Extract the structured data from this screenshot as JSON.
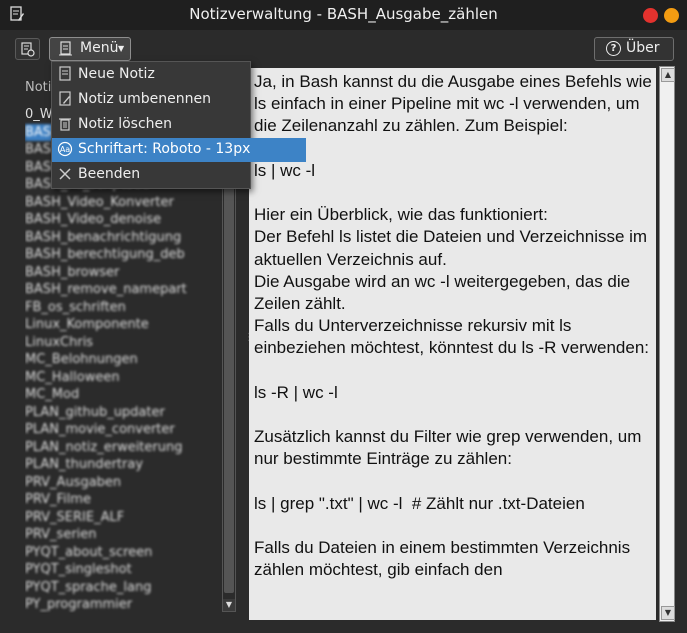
{
  "window": {
    "title": "Notizverwaltung - BASH_Ausgabe_zählen",
    "colors": {
      "close": "#e3322e",
      "minimize": "#f39c12",
      "selection": "#3c7fc2"
    }
  },
  "toolbar": {
    "menu_label": "Menü",
    "about_label": "Über"
  },
  "sidebar": {
    "header": "Noti",
    "notes": [
      "0_W...",
      "BASH_Ausgabe_zählen",
      "BASH_PDF_Verkleinern",
      "BASH_PDF_tail_bat_cat",
      "BASH_PY_scriptbau",
      "BASH_Video_Konverter",
      "BASH_Video_denoise",
      "BASH_benachrichtigung",
      "BASH_berechtigung_deb",
      "BASH_browser",
      "BASH_remove_namepart",
      "FB_os_schriften",
      "Linux_Komponente",
      "LinuxChris",
      "MC_Belohnungen",
      "MC_Halloween",
      "MC_Mod",
      "PLAN_github_updater",
      "PLAN_movie_converter",
      "PLAN_notiz_erweiterung",
      "PLAN_thundertray",
      "PRV_Ausgaben",
      "PRV_Filme",
      "PRV_SERIE_ALF",
      "PRV_serien",
      "PYQT_about_screen",
      "PYQT_singleshot",
      "PYQT_sprache_lang",
      "PY_programmier"
    ],
    "selected_index": 1
  },
  "menu": {
    "items": [
      {
        "label": "Neue Notiz",
        "icon": "new-note-icon"
      },
      {
        "label": "Notiz umbenennen",
        "icon": "rename-note-icon"
      },
      {
        "label": "Notiz löschen",
        "icon": "trash-icon"
      },
      {
        "label": "Schriftart: Roboto  - 13px",
        "icon": "font-icon"
      },
      {
        "label": "Beenden",
        "icon": "exit-icon"
      }
    ],
    "highlighted_index": 3
  },
  "editor": {
    "content": "Ja, in Bash kannst du die Ausgabe eines Befehls wie ls einfach in einer Pipeline mit wc -l verwenden, um die Zeilenanzahl zu zählen. Zum Beispiel:\n\nls | wc -l\n\nHier ein Überblick, wie das funktioniert:\nDer Befehl ls listet die Dateien und Verzeichnisse im aktuellen Verzeichnis auf.\nDie Ausgabe wird an wc -l weitergegeben, das die Zeilen zählt.\nFalls du Unterverzeichnisse rekursiv mit ls einbeziehen möchtest, könntest du ls -R verwenden:\n\nls -R | wc -l\n\nZusätzlich kannst du Filter wie grep verwenden, um nur bestimmte Einträge zu zählen:\n\nls | grep \".txt\" | wc -l  # Zählt nur .txt-Dateien\n\nFalls du Dateien in einem bestimmten Verzeichnis zählen möchtest, gib einfach den"
  }
}
